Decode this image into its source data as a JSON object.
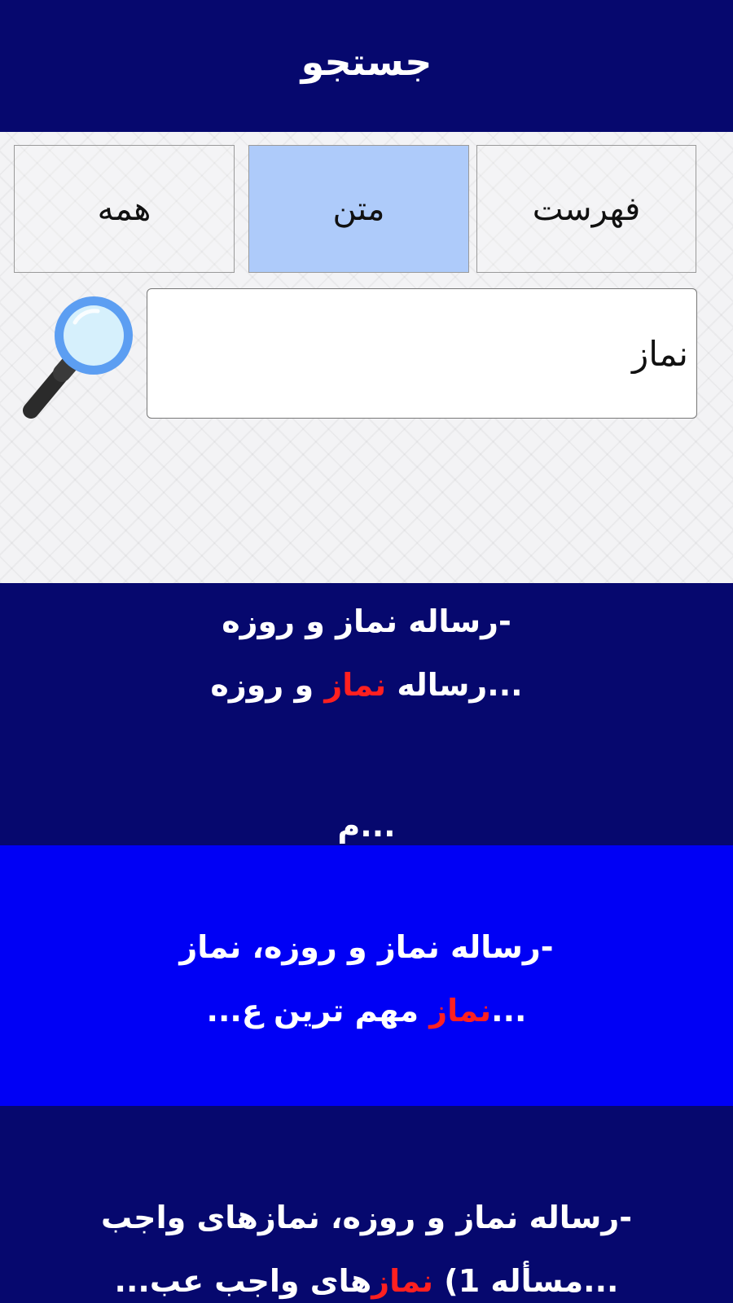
{
  "header": {
    "title": "جستجو"
  },
  "tabs": [
    {
      "label": "فهرست",
      "selected": false
    },
    {
      "label": "متن",
      "selected": true
    },
    {
      "label": "همه",
      "selected": false
    }
  ],
  "search": {
    "value": "نماز"
  },
  "results": [
    {
      "line1": "-رساله نماز و روزه",
      "line2_before": "...رساله ",
      "line2_highlight": "نماز",
      "line2_after": " و روزه",
      "trailing": "...م"
    },
    {
      "line1": "-رساله نماز و روزه، نماز",
      "line2_before": "...",
      "line2_highlight": "نماز",
      "line2_after": " مهم ترین ع..."
    },
    {
      "line1": "-رساله نماز و روزه، نمازهای واجب",
      "line2_before": "...مسأله 1) ",
      "line2_highlight": "نماز",
      "line2_after": "های واجب عب..."
    }
  ],
  "colors": {
    "header_bg": "#06086e",
    "selected_tab_bg": "#aecbfa",
    "highlight_text": "#ff2020",
    "selected_result_bg": "#0000f5"
  },
  "icons": {
    "search_button": "magnifying-glass-icon"
  }
}
